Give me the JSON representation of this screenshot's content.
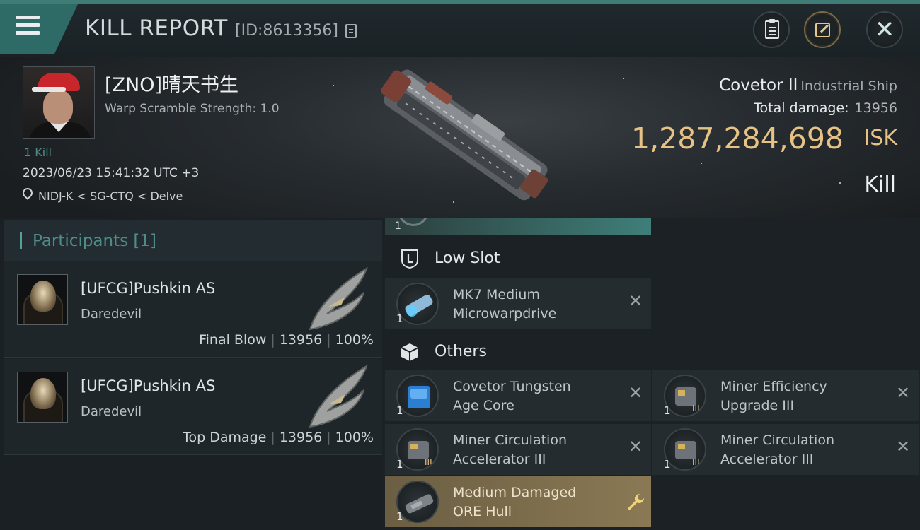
{
  "header": {
    "title": "KILL REPORT",
    "report_id": "[ID:8613356]",
    "buttons": [
      "clipboard-icon",
      "share-icon",
      "close-icon"
    ]
  },
  "victim": {
    "name": "[ZNO]晴天书生",
    "scramble_label": "Warp Scramble Strength:",
    "scramble_value": "1.0",
    "kills": "1 Kill",
    "timestamp": "2023/06/23 15:41:32 UTC +3",
    "location": "NIDJ-K < SG-CTQ < Delve",
    "ship_name": "Covetor II",
    "ship_class": "Industrial Ship",
    "total_damage_label": "Total damage:",
    "total_damage": "13956",
    "isk_value": "1,287,284,698",
    "isk_unit": "ISK",
    "result": "Kill"
  },
  "participants": {
    "title": "Participants",
    "count": "[1]",
    "rows": [
      {
        "name": "[UFCG]Pushkin AS",
        "ship": "Daredevil",
        "role": "Final Blow",
        "damage": "13956",
        "percent": "100%"
      },
      {
        "name": "[UFCG]Pushkin AS",
        "ship": "Daredevil",
        "role": "Top Damage",
        "damage": "13956",
        "percent": "100%"
      }
    ]
  },
  "fittings": {
    "top_quantity": "1",
    "low_slot": {
      "title": "Low Slot",
      "items": [
        {
          "name_line1": "MK7 Medium",
          "name_line2": "Microwarpdrive",
          "qty": "1"
        }
      ]
    },
    "others": {
      "title": "Others",
      "items": [
        {
          "name_line1": "Covetor Tungsten",
          "name_line2": "Age Core",
          "qty": "1"
        },
        {
          "name_line1": "Miner Efficiency",
          "name_line2": "Upgrade III",
          "qty": "1"
        },
        {
          "name_line1": "Miner Circulation",
          "name_line2": "Accelerator III",
          "qty": "1"
        },
        {
          "name_line1": "Miner Circulation",
          "name_line2": "Accelerator III",
          "qty": "1"
        },
        {
          "name_line1": "Medium Damaged",
          "name_line2": "ORE Hull",
          "qty": "1"
        }
      ]
    }
  },
  "colors": {
    "accent_teal": "#3f7f79",
    "isk_gold": "#e6c285",
    "salvage_gold": "#8a7954"
  }
}
